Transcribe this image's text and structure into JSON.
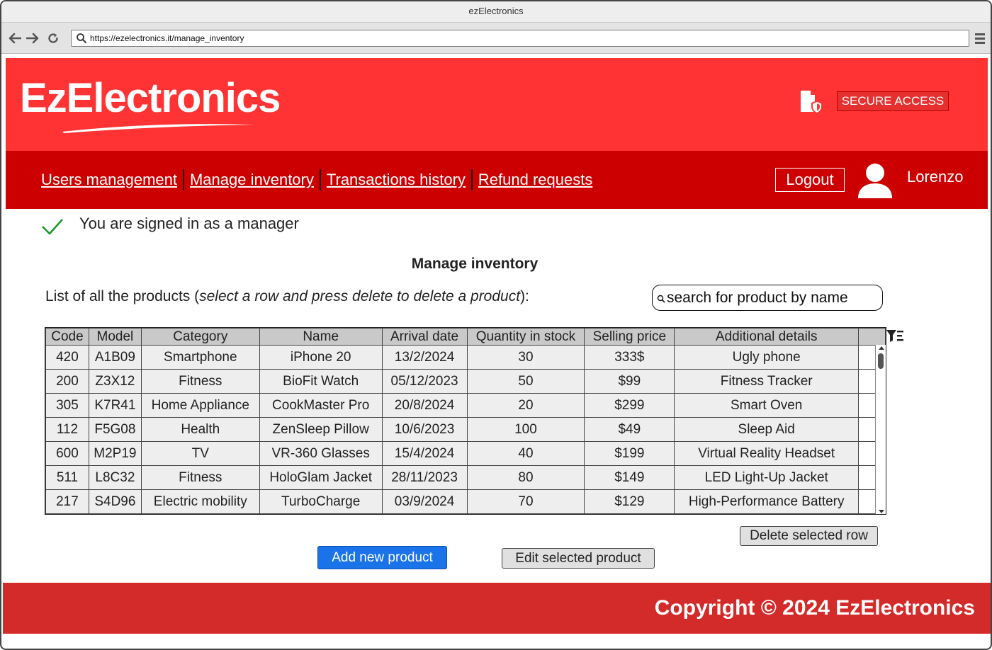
{
  "browser": {
    "window_title": "ezElectronics",
    "url": "https://ezelectronics.it/manage_inventory"
  },
  "header": {
    "logo_text": "EzElectronics",
    "secure_label": "SECURE ACCESS"
  },
  "nav": {
    "links": [
      "Users management",
      "Manage inventory",
      "Transactions history",
      "Refund requests"
    ],
    "logout_label": "Logout",
    "username": "Lorenzo"
  },
  "status": {
    "signed_in_text": "You are signed in as a manager"
  },
  "main": {
    "title": "Manage inventory",
    "list_caption_prefix": "List of all the products (",
    "list_caption_italic": "select a row and press delete to delete a product",
    "list_caption_suffix": "):",
    "search_placeholder": "search for product by name"
  },
  "table": {
    "headers": [
      "Code",
      "Model",
      "Category",
      "Name",
      "Arrival date",
      "Quantity in stock",
      "Selling price",
      "Additional details"
    ],
    "rows": [
      [
        "420",
        "A1B09",
        "Smartphone",
        "iPhone 20",
        "13/2/2024",
        "30",
        "333$",
        "Ugly phone"
      ],
      [
        "200",
        "Z3X12",
        "Fitness",
        "BioFit Watch",
        "05/12/2023",
        "50",
        "$99",
        "Fitness Tracker"
      ],
      [
        "305",
        "K7R41",
        "Home Appliance",
        "CookMaster Pro",
        "20/8/2024",
        "20",
        "$299",
        "Smart Oven"
      ],
      [
        "112",
        "F5G08",
        "Health",
        "ZenSleep Pillow",
        "10/6/2023",
        "100",
        "$49",
        "Sleep Aid"
      ],
      [
        "600",
        "M2P19",
        "TV",
        "VR-360 Glasses",
        "15/4/2024",
        "40",
        "$199",
        "Virtual Reality Headset"
      ],
      [
        "511",
        "L8C32",
        "Fitness",
        "HoloGlam Jacket",
        "28/11/2023",
        "80",
        "$149",
        "LED Light-Up Jacket"
      ],
      [
        "217",
        "S4D96",
        "Electric mobility",
        "TurboCharge",
        "03/9/2024",
        "70",
        "$129",
        "High-Performance Battery"
      ]
    ]
  },
  "actions": {
    "delete_label": "Delete selected row",
    "add_label": "Add new product",
    "edit_label": "Edit selected product"
  },
  "footer": {
    "copyright": "Copyright © 2024 EzElectronics"
  },
  "colors": {
    "header_red": "#ff3333",
    "nav_red": "#cc0000",
    "footer_red": "#d32a2a",
    "primary_blue": "#1a73e8"
  }
}
